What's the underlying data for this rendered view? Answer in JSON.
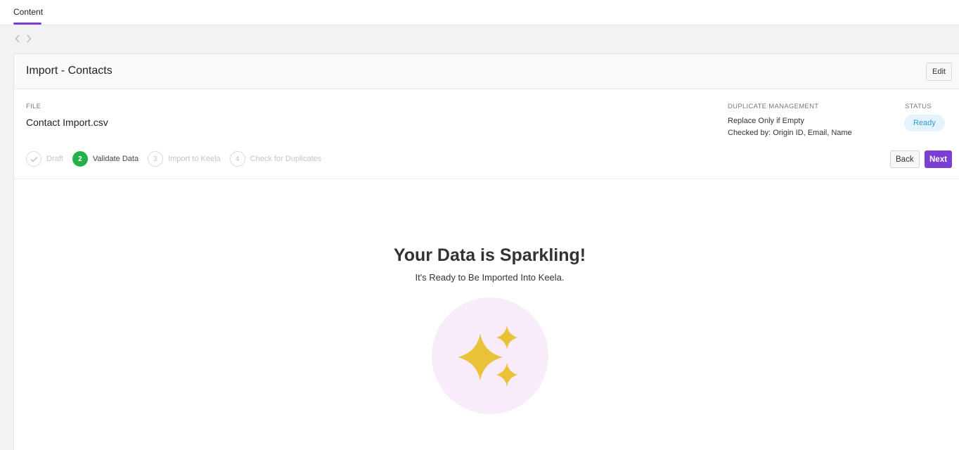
{
  "tabs": {
    "content": "Content"
  },
  "header": {
    "title": "Import - Contacts",
    "edit_label": "Edit"
  },
  "meta": {
    "file_label": "FILE",
    "file_value": "Contact Import.csv",
    "dup_label": "DUPLICATE MANAGEMENT",
    "dup_line1": "Replace Only if Empty",
    "dup_line2": "Checked by: Origin ID, Email, Name",
    "status_label": "STATUS",
    "status_value": "Ready"
  },
  "steps": [
    {
      "number": "",
      "label": "Draft",
      "state": "done"
    },
    {
      "number": "2",
      "label": "Validate Data",
      "state": "active"
    },
    {
      "number": "3",
      "label": "Import to Keela",
      "state": "pending"
    },
    {
      "number": "4",
      "label": "Check for Duplicates",
      "state": "pending"
    }
  ],
  "actions": {
    "back_label": "Back",
    "next_label": "Next"
  },
  "hero": {
    "title": "Your Data is Sparkling!",
    "subtitle": "It's Ready to Be Imported Into Keela."
  },
  "colors": {
    "accent": "#7a3fd1",
    "success": "#25b04a",
    "status_bg": "#e4f3fc",
    "status_text": "#2d9bd8",
    "sparkle": "#eac23a",
    "sparkle_bg": "#f8ecfb"
  },
  "icons": {
    "back": "chevron-left-icon",
    "forward": "chevron-right-icon",
    "done": "check-icon",
    "hero": "sparkles-icon"
  }
}
